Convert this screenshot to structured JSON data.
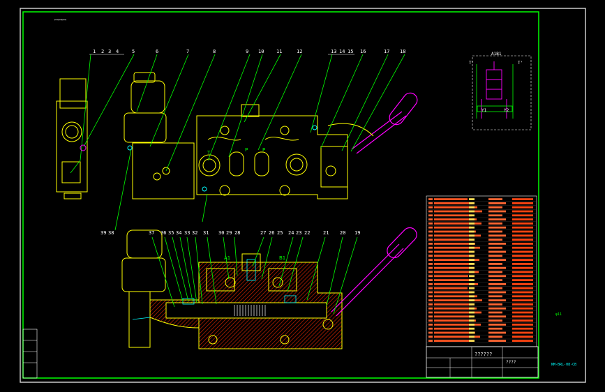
{
  "sheet": {
    "background": "#000000",
    "frame_color": "#ffffff",
    "inner_border_color": "#00ff00",
    "accent_colors": {
      "yellow": "#ffff00",
      "green": "#00ff00",
      "magenta": "#ff00ff",
      "red": "#cc2200",
      "cyan": "#00ffff"
    }
  },
  "corner_code": "ꟷꟷꟷ",
  "top_callouts": {
    "c1": "1",
    "c2": "2",
    "c3": "3",
    "c4": "4",
    "c5": "5",
    "c6": "6",
    "c7": "7",
    "c8": "8",
    "c9": "9",
    "c10": "10",
    "c11": "11",
    "c12": "12",
    "c13": "13",
    "c14": "14",
    "c15": "15",
    "c16": "16",
    "c17": "17",
    "c18": "18"
  },
  "bottom_callouts": {
    "c19": "19",
    "c20": "20",
    "c21": "21",
    "c22": "22",
    "c23": "23",
    "c24": "24",
    "c25": "25",
    "c26": "26",
    "c27": "27",
    "c28": "28",
    "c29": "29",
    "c30": "30",
    "c31": "31",
    "c32": "32",
    "c33": "33",
    "c34": "34",
    "c35": "35",
    "c36": "36",
    "c37": "37",
    "c38": "38",
    "c39": "39"
  },
  "port_labels": {
    "p1": "P",
    "p2": "P",
    "t": "T",
    "a1": "A1",
    "b1": "B1"
  },
  "schematic": {
    "title": "A1B1",
    "t_left": "T'",
    "t_right": "T'",
    "y_label": "Y1",
    "y2_label": "Y2"
  },
  "title_block": {
    "drawing_name": "??????",
    "scale": "????"
  },
  "right_note": "NM-BRL-08-CB",
  "side_mark": "φ11"
}
